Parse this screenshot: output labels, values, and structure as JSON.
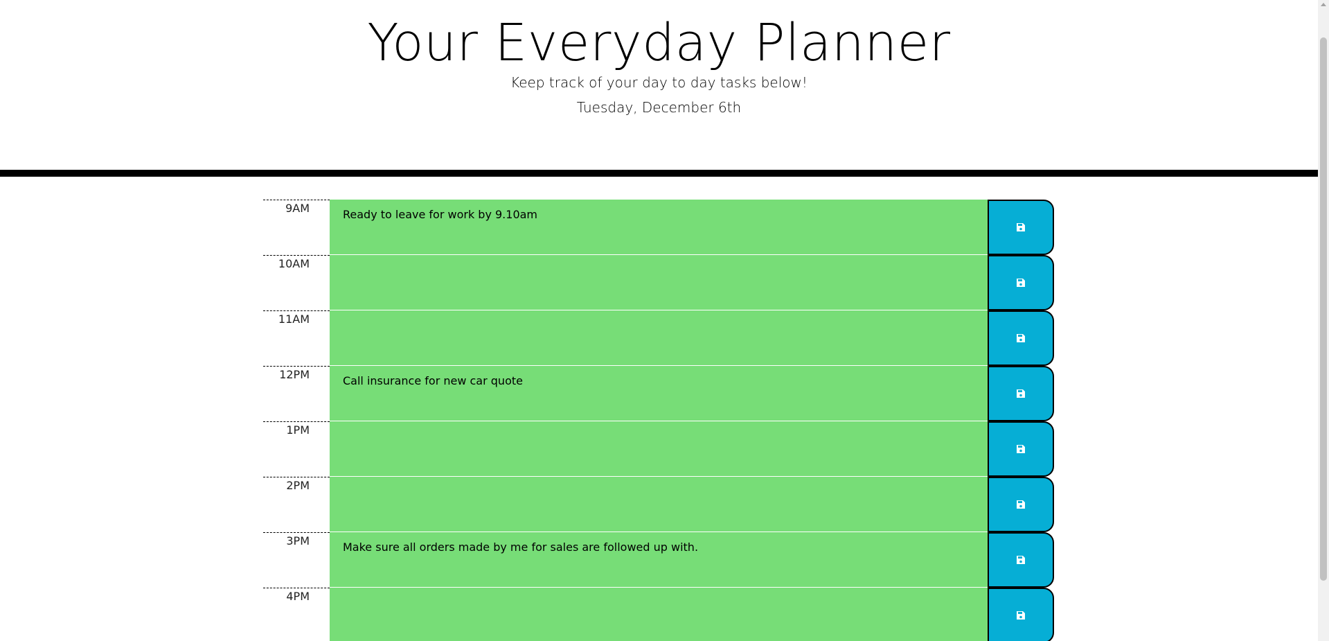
{
  "header": {
    "title": "Your Everyday Planner",
    "lead": "Keep track of your day to day tasks below!",
    "current_day": "Tuesday, December 6th"
  },
  "timeblocks": [
    {
      "hour": "9AM",
      "text": "Ready to leave for work by 9.10am"
    },
    {
      "hour": "10AM",
      "text": ""
    },
    {
      "hour": "11AM",
      "text": ""
    },
    {
      "hour": "12PM",
      "text": "Call insurance for new car quote"
    },
    {
      "hour": "1PM",
      "text": ""
    },
    {
      "hour": "2PM",
      "text": ""
    },
    {
      "hour": "3PM",
      "text": "Make sure all orders made by me for sales are followed up with."
    },
    {
      "hour": "4PM",
      "text": ""
    }
  ],
  "icons": {
    "save": "save-icon (floppy disk)"
  },
  "colors": {
    "future_block": "#77dd77",
    "save_button": "#06aed5",
    "header_border": "#000000"
  }
}
